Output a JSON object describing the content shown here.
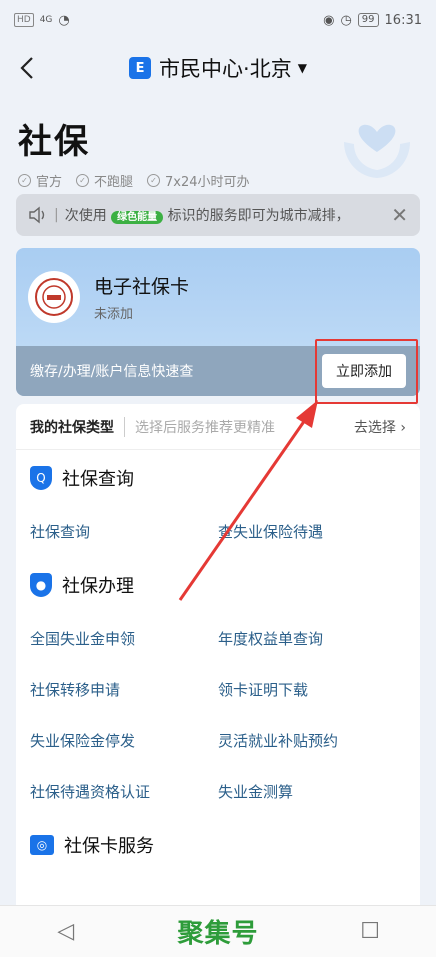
{
  "status_bar": {
    "network_badge": "HD",
    "signal": "4G",
    "battery": "99",
    "time": "16:31"
  },
  "header": {
    "title": "市民中心·北京",
    "logo_glyph": "E"
  },
  "page": {
    "title": "社保",
    "tags": [
      "官方",
      "不跑腿",
      "7x24小时可办"
    ]
  },
  "notice": {
    "prefix": "次使用",
    "badge": "绿色能量",
    "text": "标识的服务即可为城市减排，"
  },
  "ss_card": {
    "title": "电子社保卡",
    "status": "未添加",
    "description": "缴存/办理/账户信息快速查",
    "add_button": "立即添加"
  },
  "insurance_type": {
    "label": "我的社保类型",
    "hint": "选择后服务推荐更精准",
    "link": "去选择"
  },
  "sections": [
    {
      "title": "社保查询",
      "items": [
        "社保查询",
        "查失业保险待遇"
      ]
    },
    {
      "title": "社保办理",
      "items": [
        "全国失业金申领",
        "年度权益单查询",
        "社保转移申请",
        "领卡证明下载",
        "失业保险金停发",
        "灵活就业补贴预约",
        "社保待遇资格认证",
        "失业金测算"
      ]
    },
    {
      "title": "社保卡服务",
      "items": []
    }
  ],
  "bottom_nav": {
    "watermark": "聚集号"
  },
  "colors": {
    "accent": "#1a73e8",
    "highlight": "#e53935",
    "badge_green": "#3cb043"
  }
}
